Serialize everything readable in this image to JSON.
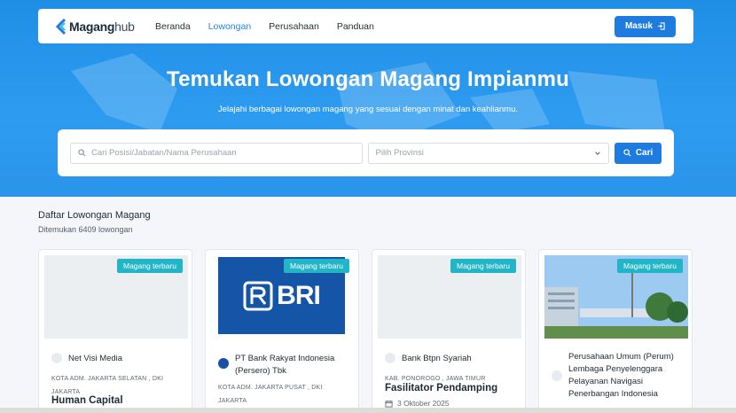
{
  "brand": {
    "name": "Magang",
    "suffix": "hub"
  },
  "nav": {
    "items": [
      "Beranda",
      "Lowongan",
      "Perusahaan",
      "Panduan"
    ],
    "active": 1,
    "login_label": "Masuk"
  },
  "hero": {
    "title": "Temukan Lowongan Magang Impianmu",
    "subtitle": "Jelajahi berbagai lowongan magang yang sesuai dengan minat dan keahlianmu."
  },
  "search": {
    "query_placeholder": "Cari Posisi/Jabatan/Nama Perusahaan",
    "province_placeholder": "Pilih Provinsi",
    "button_label": "Cari"
  },
  "listing": {
    "title": "Daftar Lowongan Magang",
    "count_text": "Ditemukan 6409 lowongan"
  },
  "cards": [
    {
      "badge": "Magang terbaru",
      "company": "Net Visi Media",
      "location": "KOTA ADM. JAKARTA SELATAN , DKI JAKARTA",
      "role": "Human Capital",
      "date": ""
    },
    {
      "badge": "Magang terbaru",
      "company": "PT Bank Rakyat Indonesia (Persero) Tbk",
      "location": "KOTA ADM. JAKARTA PUSAT , DKI JAKARTA",
      "role": "",
      "date": "",
      "logo_text": "BRI"
    },
    {
      "badge": "Magang terbaru",
      "company": "Bank Btpn Syariah",
      "location": "KAB. PONOROGO , JAWA TIMUR",
      "role": "Fasilitator Pendamping",
      "date": "3 Oktober 2025"
    },
    {
      "badge": "Magang terbaru",
      "company": "Perusahaan Umum (Perum) Lembaga Penyelenggara Pelayanan Navigasi Penerbangan Indonesia",
      "location": "",
      "role": "",
      "date": ""
    }
  ],
  "colors": {
    "primary": "#1e7be0",
    "hero": "#2d9bf0",
    "badge": "#22b5c7"
  }
}
